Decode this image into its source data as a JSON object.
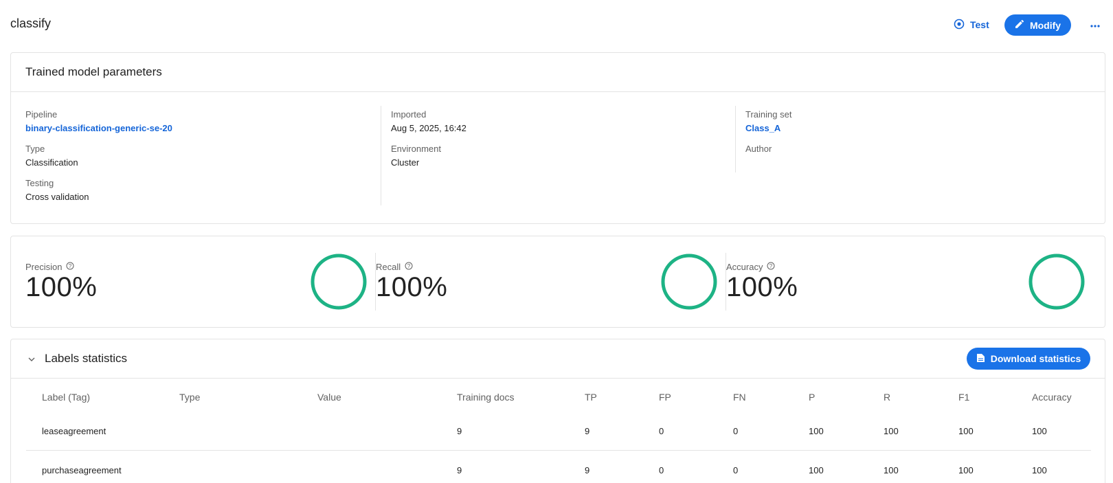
{
  "header": {
    "title": "classify",
    "test_label": "Test",
    "modify_label": "Modify",
    "more_icon": "more-horizontal-icon"
  },
  "params": {
    "title": "Trained model parameters",
    "pipeline_label": "Pipeline",
    "pipeline_value": "binary-classification-generic-se-20",
    "type_label": "Type",
    "type_value": "Classification",
    "testing_label": "Testing",
    "testing_value": "Cross validation",
    "imported_label": "Imported",
    "imported_value": "Aug 5, 2025, 16:42",
    "environment_label": "Environment",
    "environment_value": "Cluster",
    "training_set_label": "Training set",
    "training_set_value": "Class_A",
    "author_label": "Author"
  },
  "metrics": [
    {
      "label": "Precision",
      "value": "100%",
      "fraction": 1.0
    },
    {
      "label": "Recall",
      "value": "100%",
      "fraction": 1.0
    },
    {
      "label": "Accuracy",
      "value": "100%",
      "fraction": 1.0
    }
  ],
  "labels_stats": {
    "title": "Labels statistics",
    "download_label": "Download statistics",
    "columns": [
      "Label (Tag)",
      "Type",
      "Value",
      "Training docs",
      "TP",
      "FP",
      "FN",
      "P",
      "R",
      "F1",
      "Accuracy"
    ],
    "rows": [
      [
        "leaseagreement",
        "",
        "",
        "9",
        "9",
        "0",
        "0",
        "100",
        "100",
        "100",
        "100"
      ],
      [
        "purchaseagreement",
        "",
        "",
        "9",
        "9",
        "0",
        "0",
        "100",
        "100",
        "100",
        "100"
      ]
    ]
  },
  "colors": {
    "accent": "#1a73e8",
    "link": "#1565d8",
    "ring": "#1db385"
  }
}
